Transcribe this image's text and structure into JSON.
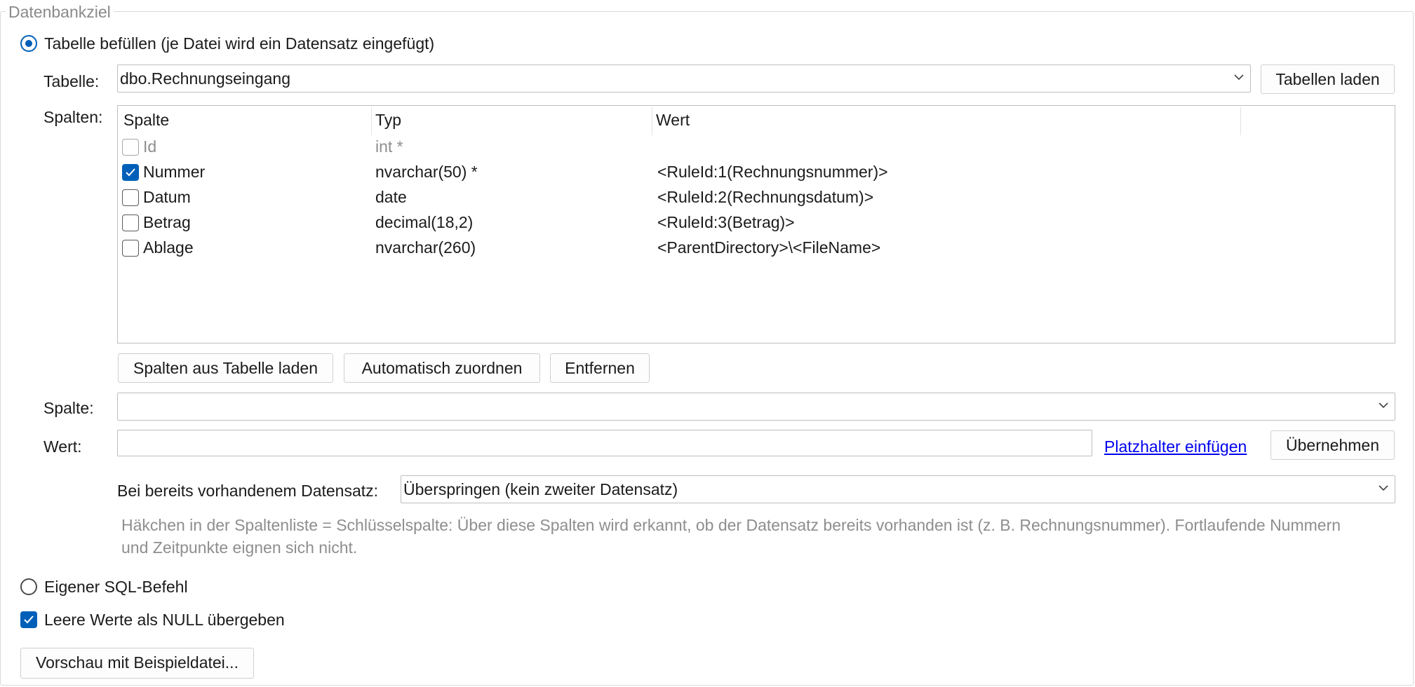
{
  "group": {
    "legend": "Datenbankziel"
  },
  "mode_table": {
    "label": "Tabelle befüllen (je Datei wird ein Datensatz eingefügt)",
    "selected": true
  },
  "table": {
    "label": "Tabelle:",
    "value": "dbo.Rechnungseingang",
    "load_button": "Tabellen laden"
  },
  "columns": {
    "label": "Spalten:",
    "headers": {
      "col": "Spalte",
      "type": "Typ",
      "value": "Wert"
    },
    "rows": [
      {
        "name": "Id",
        "type": "int *",
        "value": "",
        "checked": false,
        "disabled": true
      },
      {
        "name": "Nummer",
        "type": "nvarchar(50) *",
        "value": "<RuleId:1(Rechnungsnummer)>",
        "checked": true,
        "disabled": false
      },
      {
        "name": "Datum",
        "type": "date",
        "value": "<RuleId:2(Rechnungsdatum)>",
        "checked": false,
        "disabled": false
      },
      {
        "name": "Betrag",
        "type": "decimal(18,2)",
        "value": "<RuleId:3(Betrag)>",
        "checked": false,
        "disabled": false
      },
      {
        "name": "Ablage",
        "type": "nvarchar(260)",
        "value": "<ParentDirectory>\\<FileName>",
        "checked": false,
        "disabled": false
      }
    ],
    "buttons": {
      "load_from_table": "Spalten aus Tabelle laden",
      "auto_assign": "Automatisch zuordnen",
      "remove": "Entfernen"
    }
  },
  "column_edit": {
    "label": "Spalte:",
    "value": ""
  },
  "value_edit": {
    "label": "Wert:",
    "value": "",
    "insert_placeholder": "Platzhalter einfügen",
    "apply_button": "Übernehmen"
  },
  "existing": {
    "label": "Bei bereits vorhandenem Datensatz:",
    "value": "Überspringen (kein zweiter Datensatz)"
  },
  "hint": {
    "line1": "Häkchen in der Spaltenliste = Schlüsselspalte: Über diese Spalten wird erkannt, ob der Datensatz bereits vorhanden ist (z. B. Rechnungsnummer). Fortlaufende Nummern",
    "line2": "und Zeitpunkte eignen sich nicht."
  },
  "mode_sql": {
    "label": "Eigener SQL-Befehl",
    "selected": false
  },
  "null_values": {
    "label": "Leere Werte als NULL übergeben",
    "checked": true
  },
  "preview_button": "Vorschau mit Beispieldatei...",
  "colors": {
    "accent": "#005fb8",
    "link": "#0000ee",
    "hint": "#8e8e8e"
  }
}
